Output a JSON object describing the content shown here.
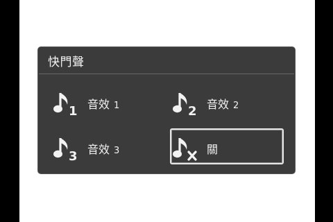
{
  "dialog": {
    "title": "快門聲",
    "options": [
      {
        "label": "音效",
        "number": "1",
        "icon": "music-note-1-icon",
        "selected": false
      },
      {
        "label": "音效",
        "number": "2",
        "icon": "music-note-2-icon",
        "selected": false
      },
      {
        "label": "音效",
        "number": "3",
        "icon": "music-note-3-icon",
        "selected": false
      },
      {
        "label": "關",
        "number": "",
        "icon": "music-note-off-icon",
        "selected": true
      }
    ]
  },
  "colors": {
    "panel_bg": "#3b3b3b",
    "text": "#f2f2f2",
    "selection_border": "#e6e6e6"
  }
}
